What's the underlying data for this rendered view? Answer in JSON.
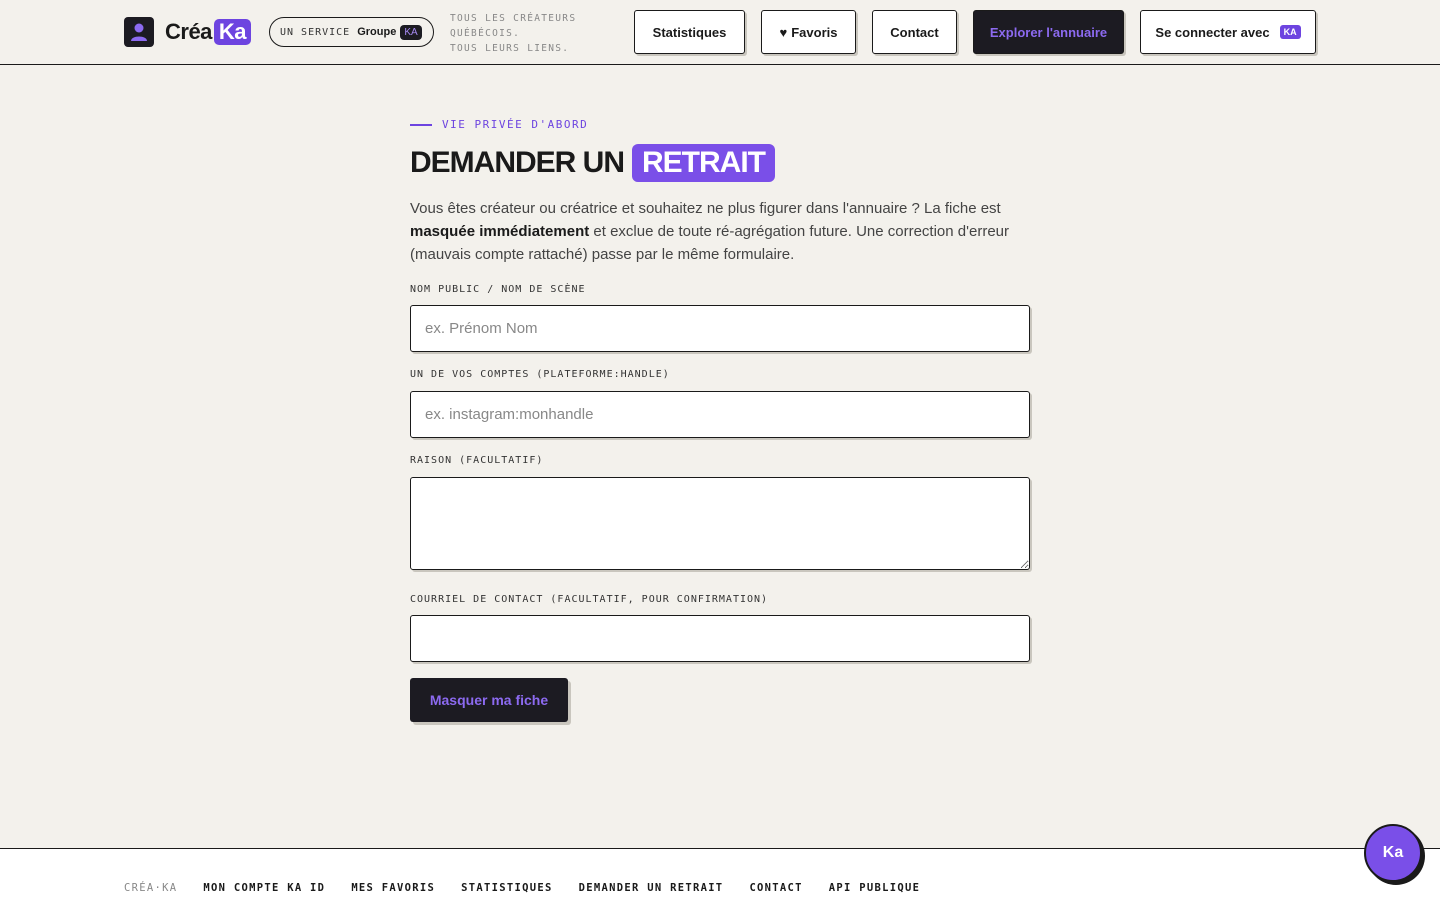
{
  "header": {
    "logo_main": "Créa",
    "logo_accent": "Ka",
    "service_prefix": "UN SERVICE",
    "service_group": "Groupe",
    "service_badge": "KA",
    "tagline_1": "TOUS LES CRÉATEURS",
    "tagline_2": "QUÉBÉCOIS.",
    "tagline_3": "TOUS LEURS LIENS.",
    "nav": {
      "stats": "Statistiques",
      "favorites": "Favoris",
      "contact": "Contact",
      "explore": "Explorer l'annuaire",
      "login": "Se connecter avec",
      "login_badge": "KA"
    }
  },
  "main": {
    "eyebrow": "VIE PRIVÉE D'ABORD",
    "title_prefix": "DEMANDER UN",
    "title_highlight": "RETRAIT",
    "intro_1": "Vous êtes créateur ou créatrice et souhaitez ne plus figurer dans l'annuaire ? La fiche est ",
    "intro_bold": "masquée immédiatement",
    "intro_2": " et exclue de toute ré-agrégation future. Une correction d'erreur (mauvais compte rattaché) passe par le même formulaire.",
    "fields": {
      "name_label": "NOM PUBLIC / NOM DE SCÈNE",
      "name_placeholder": "ex. Prénom Nom",
      "account_label": "UN DE VOS COMPTES (PLATEFORME:HANDLE)",
      "account_placeholder": "ex. instagram:monhandle",
      "reason_label": "RAISON (FACULTATIF)",
      "email_label": "COURRIEL DE CONTACT (FACULTATIF, POUR CONFIRMATION)"
    },
    "submit": "Masquer ma fiche"
  },
  "footer": {
    "brand": "CRÉA·KA",
    "links": [
      "MON COMPTE KA ID",
      "MES FAVORIS",
      "STATISTIQUES",
      "DEMANDER UN RETRAIT",
      "CONTACT",
      "API PUBLIQUE"
    ]
  },
  "fab_label": "Ka",
  "colors": {
    "accent": "#6d44e0",
    "dark": "#1c1b22",
    "background": "#f3f1ec"
  }
}
